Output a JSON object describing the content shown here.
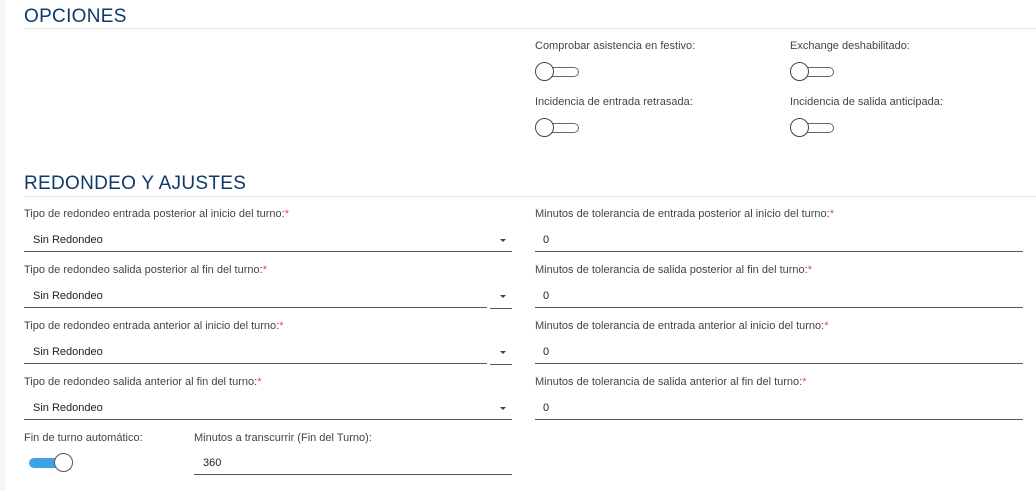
{
  "opciones": {
    "title": "OPCIONES",
    "toggles": [
      {
        "label": "Comprobar asistencia en festivo:",
        "on": false
      },
      {
        "label": "Exchange deshabilitado:",
        "on": false
      },
      {
        "label": "Incidencia de entrada retrasada:",
        "on": false
      },
      {
        "label": "Incidencia de salida anticipada:",
        "on": false
      }
    ]
  },
  "redondeo": {
    "title": "REDONDEO Y AJUSTES",
    "selects": [
      {
        "label": "Tipo de redondeo entrada posterior al inicio del turno:",
        "required": "*",
        "value": "Sin Redondeo"
      },
      {
        "label": "Tipo de redondeo salida posterior al fin del turno:",
        "required": "*",
        "value": "Sin Redondeo"
      },
      {
        "label": "Tipo de redondeo entrada anterior al inicio del turno:",
        "required": "*",
        "value": "Sin Redondeo"
      },
      {
        "label": "Tipo de redondeo salida anterior al fin del turno:",
        "required": "*",
        "value": "Sin Redondeo"
      }
    ],
    "tolerances": [
      {
        "label": "Minutos de tolerancia de entrada posterior al inicio del turno:",
        "required": "*",
        "value": "0"
      },
      {
        "label": "Minutos de tolerancia de salida posterior al fin del turno:",
        "required": "*",
        "value": "0"
      },
      {
        "label": "Minutos de tolerancia de entrada anterior al inicio del turno:",
        "required": "*",
        "value": "0"
      },
      {
        "label": "Minutos de tolerancia de salida anterior al fin del turno:",
        "required": "*",
        "value": "0"
      }
    ],
    "auto_end": {
      "label": "Fin de turno automático:",
      "on": true
    },
    "minutes": {
      "label": "Minutos a transcurrir (Fin del Turno):",
      "value": "360"
    }
  },
  "colors": {
    "title": "#0d3a6b",
    "toggle_on": "#3ea2ea",
    "required": "#e04b4b"
  }
}
